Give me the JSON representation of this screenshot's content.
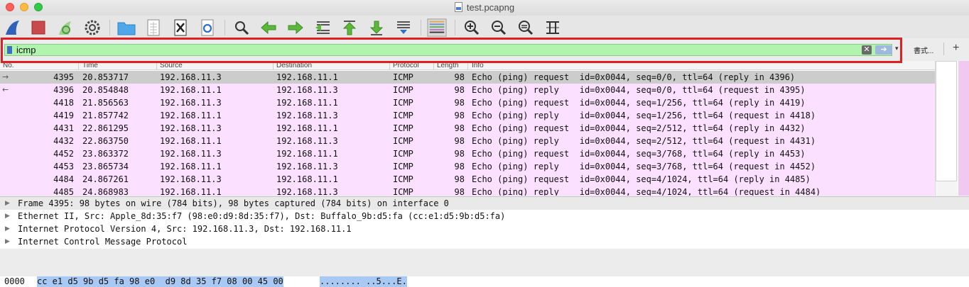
{
  "window": {
    "title": "test.pcapng"
  },
  "filter": {
    "value": "icmp",
    "format_label": "書式...",
    "plus_label": "+"
  },
  "columns": [
    "No.",
    "Time",
    "Source",
    "Destination",
    "Protocol",
    "Length",
    "Info"
  ],
  "packets": [
    {
      "no": "4395",
      "time": "20.853717",
      "src": "192.168.11.3",
      "dst": "192.168.11.1",
      "proto": "ICMP",
      "len": "98",
      "info": "Echo (ping) request  id=0x0044, seq=0/0, ttl=64 (reply in 4396)",
      "selected": true,
      "arrow": "→"
    },
    {
      "no": "4396",
      "time": "20.854848",
      "src": "192.168.11.1",
      "dst": "192.168.11.3",
      "proto": "ICMP",
      "len": "98",
      "info": "Echo (ping) reply    id=0x0044, seq=0/0, ttl=64 (request in 4395)",
      "selected": false,
      "arrow": "←"
    },
    {
      "no": "4418",
      "time": "21.856563",
      "src": "192.168.11.3",
      "dst": "192.168.11.1",
      "proto": "ICMP",
      "len": "98",
      "info": "Echo (ping) request  id=0x0044, seq=1/256, ttl=64 (reply in 4419)",
      "selected": false,
      "arrow": ""
    },
    {
      "no": "4419",
      "time": "21.857742",
      "src": "192.168.11.1",
      "dst": "192.168.11.3",
      "proto": "ICMP",
      "len": "98",
      "info": "Echo (ping) reply    id=0x0044, seq=1/256, ttl=64 (request in 4418)",
      "selected": false,
      "arrow": ""
    },
    {
      "no": "4431",
      "time": "22.861295",
      "src": "192.168.11.3",
      "dst": "192.168.11.1",
      "proto": "ICMP",
      "len": "98",
      "info": "Echo (ping) request  id=0x0044, seq=2/512, ttl=64 (reply in 4432)",
      "selected": false,
      "arrow": ""
    },
    {
      "no": "4432",
      "time": "22.863750",
      "src": "192.168.11.1",
      "dst": "192.168.11.3",
      "proto": "ICMP",
      "len": "98",
      "info": "Echo (ping) reply    id=0x0044, seq=2/512, ttl=64 (request in 4431)",
      "selected": false,
      "arrow": ""
    },
    {
      "no": "4452",
      "time": "23.863372",
      "src": "192.168.11.3",
      "dst": "192.168.11.1",
      "proto": "ICMP",
      "len": "98",
      "info": "Echo (ping) request  id=0x0044, seq=3/768, ttl=64 (reply in 4453)",
      "selected": false,
      "arrow": ""
    },
    {
      "no": "4453",
      "time": "23.865734",
      "src": "192.168.11.1",
      "dst": "192.168.11.3",
      "proto": "ICMP",
      "len": "98",
      "info": "Echo (ping) reply    id=0x0044, seq=3/768, ttl=64 (request in 4452)",
      "selected": false,
      "arrow": ""
    },
    {
      "no": "4484",
      "time": "24.867261",
      "src": "192.168.11.3",
      "dst": "192.168.11.1",
      "proto": "ICMP",
      "len": "98",
      "info": "Echo (ping) request  id=0x0044, seq=4/1024, ttl=64 (reply in 4485)",
      "selected": false,
      "arrow": ""
    },
    {
      "no": "4485",
      "time": "24.868983",
      "src": "192.168.11.1",
      "dst": "192.168.11.3",
      "proto": "ICMP",
      "len": "98",
      "info": "Echo (ping) reply    id=0x0044, seq=4/1024, ttl=64 (request in 4484)",
      "selected": false,
      "arrow": ""
    }
  ],
  "details": [
    "Frame 4395: 98 bytes on wire (784 bits), 98 bytes captured (784 bits) on interface 0",
    "Ethernet II, Src: Apple_8d:35:f7 (98:e0:d9:8d:35:f7), Dst: Buffalo_9b:d5:fa (cc:e1:d5:9b:d5:fa)",
    "Internet Protocol Version 4, Src: 192.168.11.3, Dst: 192.168.11.1",
    "Internet Control Message Protocol"
  ],
  "bytes": {
    "offset": "0000",
    "hex": "cc e1 d5 9b d5 fa 98 e0  d9 8d 35 f7 08 00 45 00",
    "ascii": "........ ..5...E."
  },
  "colors": {
    "row_bg": "#fce0ff",
    "row_selected": "#cccccc",
    "filter_ok": "#b0f4ad",
    "highlight_box": "#e02020"
  }
}
